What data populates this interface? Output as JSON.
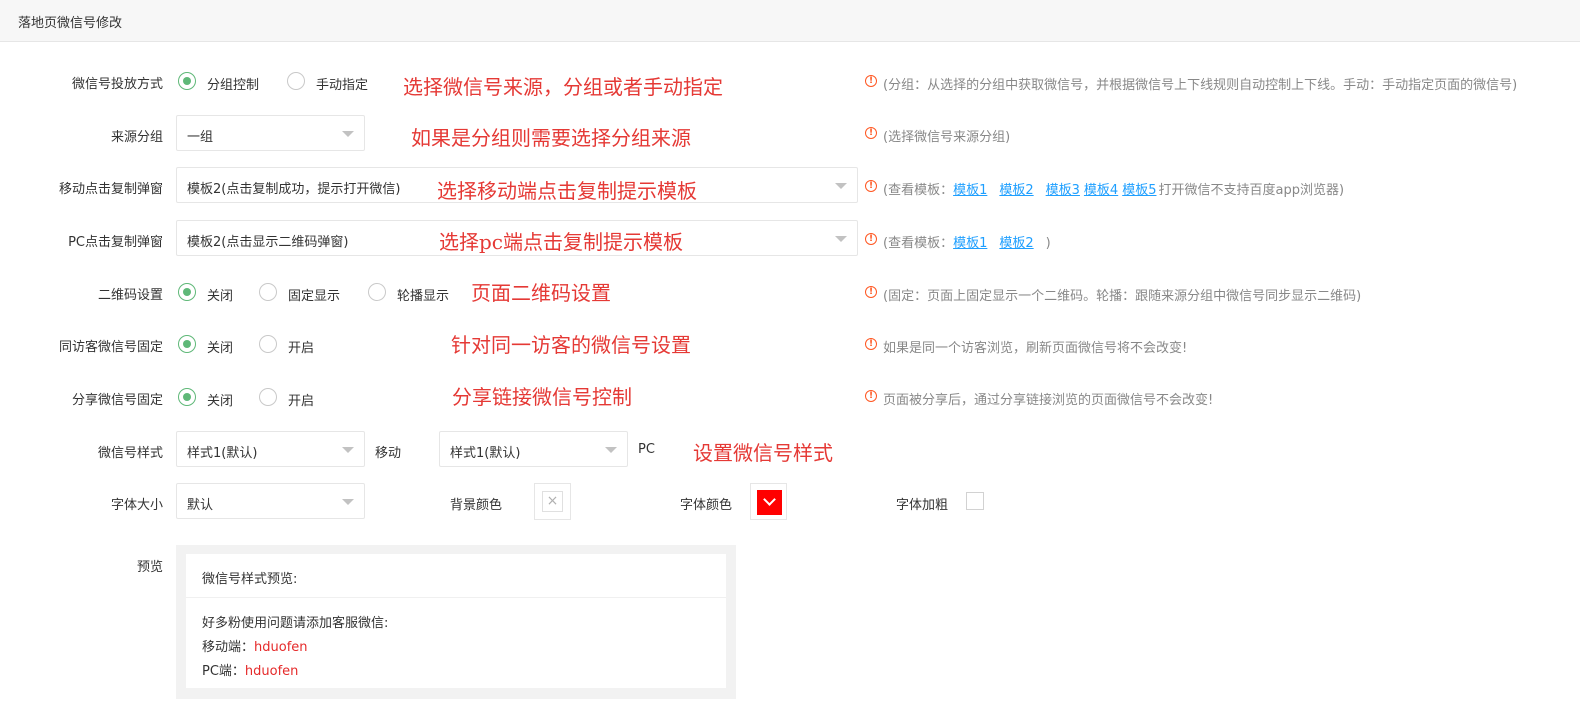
{
  "header": {
    "title": "落地页微信号修改"
  },
  "rows": {
    "source_mode": {
      "label": "微信号投放方式",
      "options": [
        "分组控制",
        "手动指定"
      ],
      "selected": "分组控制",
      "annotation": "选择微信号来源，分组或者手动指定",
      "tip": "(分组：从选择的分组中获取微信号，并根据微信号上下线规则自动控制上下线。手动：手动指定页面的微信号)"
    },
    "group": {
      "label": "来源分组",
      "value": "一组",
      "annotation": "如果是分组则需要选择分组来源",
      "tip": "(选择微信号来源分组)"
    },
    "mobile_popup": {
      "label": "移动点击复制弹窗",
      "value": "模板2(点击复制成功，提示打开微信)",
      "annotation": "选择移动端点击复制提示模板",
      "tip_prefix": "(查看模板：",
      "links": [
        "模板1",
        "模板2",
        "模板3",
        "模板4",
        "模板5"
      ],
      "tip_suffix": "打开微信不支持百度app浏览器)"
    },
    "pc_popup": {
      "label": "PC点击复制弹窗",
      "value": "模板2(点击显示二维码弹窗)",
      "annotation": "选择pc端点击复制提示模板",
      "tip_prefix": "(查看模板：",
      "links": [
        "模板1",
        "模板2"
      ],
      "tip_suffix": ")"
    },
    "qrcode": {
      "label": "二维码设置",
      "options": [
        "关闭",
        "固定显示",
        "轮播显示"
      ],
      "selected": "关闭",
      "annotation": "页面二维码设置",
      "tip": "(固定：页面上固定显示一个二维码。轮播：跟随来源分组中微信号同步显示二维码)"
    },
    "same_visitor": {
      "label": "同访客微信号固定",
      "options": [
        "关闭",
        "开启"
      ],
      "selected": "关闭",
      "annotation": "针对同一访客的微信号设置",
      "tip": "如果是同一个访客浏览，刷新页面微信号将不会改变!"
    },
    "share": {
      "label": "分享微信号固定",
      "options": [
        "关闭",
        "开启"
      ],
      "selected": "关闭",
      "annotation": "分享链接微信号控制",
      "tip": "页面被分享后，通过分享链接浏览的页面微信号不会改变!"
    },
    "style": {
      "label": "微信号样式",
      "mobile_value": "样式1(默认)",
      "mobile_label": "移动",
      "pc_value": "样式1(默认)",
      "pc_label": "PC",
      "annotation": "设置微信号样式"
    },
    "font": {
      "label": "字体大小",
      "size_value": "默认",
      "bg_label": "背景颜色",
      "color_label": "字体颜色",
      "color_value": "#ff0000",
      "bold_label": "字体加粗"
    }
  },
  "preview": {
    "label": "预览",
    "card_title": "微信号样式预览:",
    "intro": "好多粉使用问题请添加客服微信:",
    "mobile_label": "移动端：",
    "mobile_value": "hduofen",
    "pc_label": "PC端：",
    "pc_value": "hduofen"
  },
  "colors": {
    "accent": "#5fb878",
    "annotation": "#e53935",
    "link": "#1e9fff",
    "warn": "#ff5722"
  }
}
